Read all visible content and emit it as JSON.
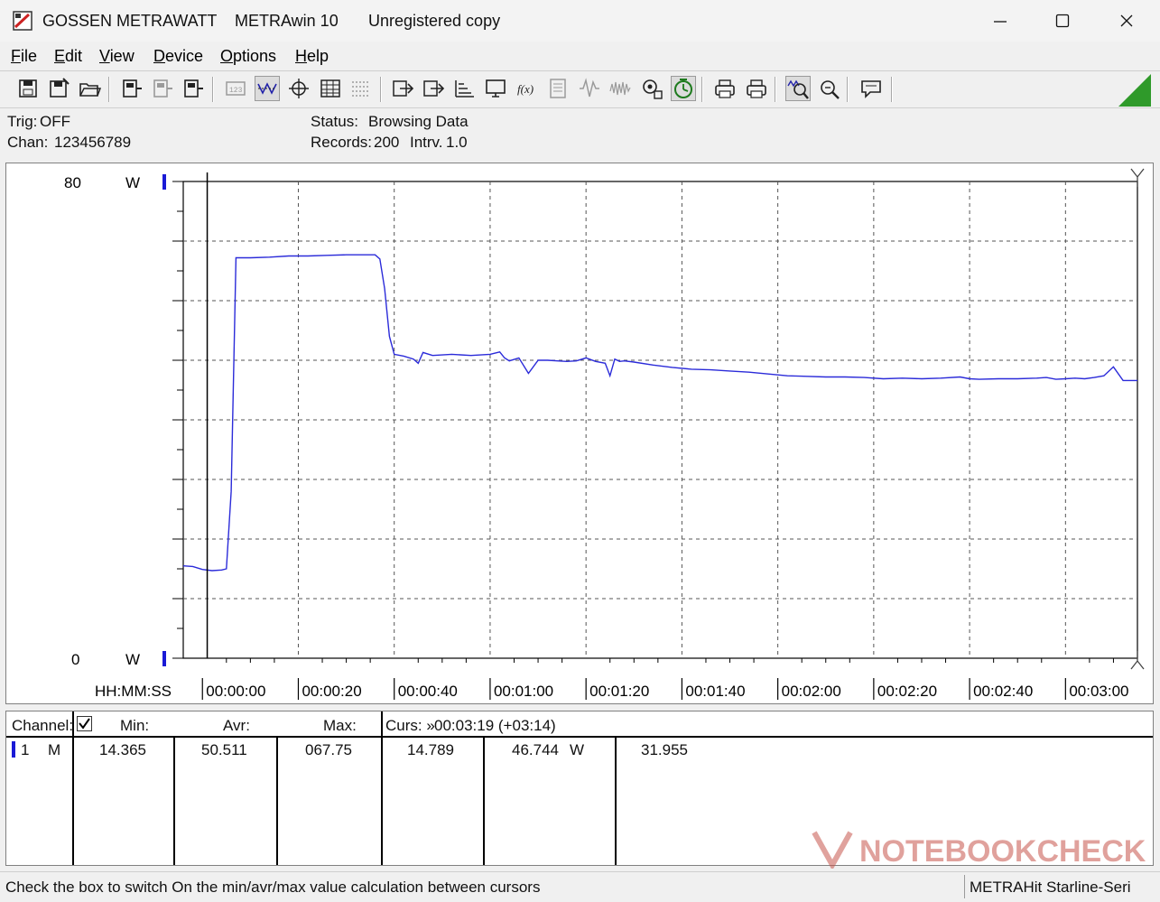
{
  "window": {
    "brand": "GOSSEN METRAWATT",
    "app": "METRAwin 10",
    "registration": "Unregistered copy"
  },
  "menu": [
    {
      "label": "File",
      "key": "F",
      "rest": "ile"
    },
    {
      "label": "Edit",
      "key": "E",
      "rest": "dit"
    },
    {
      "label": "View",
      "key": "V",
      "rest": "iew"
    },
    {
      "label": "Device",
      "key": "D",
      "rest": "evice"
    },
    {
      "label": "Options",
      "key": "O",
      "rest": "ptions"
    },
    {
      "label": "Help",
      "key": "H",
      "rest": "elp"
    }
  ],
  "toolbar_icons": [
    "save-icon",
    "save-as-icon",
    "open-folder-icon",
    "device-read-icon",
    "device-config-icon",
    "device-send-icon",
    "digital-display-icon",
    "waveform-icon",
    "crosshair-icon",
    "table-icon",
    "list-icon",
    "export-icon",
    "import-icon",
    "scale-icon",
    "monitor-icon",
    "formula-icon",
    "memory-icon",
    "signal-icon",
    "noise-icon",
    "settings-icon",
    "timer-icon",
    "print-preview-icon",
    "print-icon",
    "zoom-wave-icon",
    "zoom-icon",
    "message-icon"
  ],
  "info": {
    "trig_label": "Trig:",
    "trig_value": "OFF",
    "chan_label": "Chan:",
    "chan_value": "123456789",
    "status_label": "Status:",
    "status_value": "Browsing Data",
    "records_label": "Records:",
    "records_value": "200",
    "interval_label": "Intrv.",
    "interval_value": "1.0"
  },
  "chart_data": {
    "type": "line",
    "xlabel": "HH:MM:SS",
    "y_top_label": "80",
    "y_bottom_label": "0",
    "y_unit": "W",
    "ylim": [
      0,
      80
    ],
    "xlim": [
      -4,
      195
    ],
    "x_tick_labels": [
      "00:00:00",
      "00:00:20",
      "00:00:40",
      "00:01:00",
      "00:01:20",
      "00:01:40",
      "00:02:00",
      "00:02:20",
      "00:02:40",
      "00:03:00"
    ],
    "x_tick_values": [
      0,
      20,
      40,
      60,
      80,
      100,
      120,
      140,
      160,
      180
    ],
    "grid": true,
    "line_color": "#2b2bd9",
    "cursor_x": 1,
    "series": [
      {
        "x": [
          -4,
          -2,
          0,
          2,
          4,
          5,
          6,
          7,
          8,
          10,
          14,
          18,
          22,
          26,
          30,
          34,
          36,
          37,
          38,
          39,
          40,
          42,
          44,
          45,
          46,
          48,
          52,
          56,
          60,
          62,
          63,
          64,
          66,
          68,
          70,
          72,
          74,
          76,
          78,
          80,
          82,
          84,
          85,
          86,
          87,
          88,
          90,
          94,
          98,
          102,
          106,
          110,
          114,
          118,
          122,
          126,
          130,
          134,
          138,
          142,
          146,
          150,
          154,
          158,
          160,
          162,
          166,
          170,
          174,
          176,
          178,
          180,
          182,
          184,
          186,
          188,
          190,
          192,
          195
        ],
        "y": [
          15.5,
          15.4,
          14.9,
          14.7,
          14.8,
          15.0,
          28.0,
          67.2,
          67.2,
          67.2,
          67.3,
          67.5,
          67.5,
          67.6,
          67.7,
          67.7,
          67.7,
          67.0,
          62.0,
          54.0,
          51.0,
          50.7,
          50.2,
          49.5,
          51.3,
          50.8,
          51.0,
          50.8,
          51.0,
          51.4,
          50.4,
          49.9,
          50.4,
          47.8,
          50.0,
          50.0,
          49.9,
          49.8,
          49.9,
          50.4,
          49.8,
          49.5,
          47.4,
          50.2,
          49.8,
          49.9,
          49.7,
          49.2,
          48.8,
          48.5,
          48.4,
          48.2,
          48.0,
          47.7,
          47.4,
          47.3,
          47.2,
          47.2,
          47.1,
          46.9,
          47.0,
          46.9,
          47.0,
          47.2,
          46.9,
          46.8,
          46.9,
          46.9,
          47.0,
          47.1,
          46.8,
          46.9,
          47.0,
          46.9,
          47.1,
          47.4,
          48.9,
          46.6,
          46.6
        ]
      }
    ]
  },
  "table": {
    "channel_header": "Channel:",
    "min_header": "Min:",
    "avr_header": "Avr:",
    "max_header": "Max:",
    "curs_label": "Curs: »",
    "curs_value": "00:03:19 (+03:14)",
    "row": {
      "channel": "1",
      "mode": "M",
      "min": "14.365",
      "avr": "50.511",
      "max": "067.75",
      "cursor1": "14.789",
      "cursor2": "46.744",
      "unit": "W",
      "delta": "31.955"
    }
  },
  "status": {
    "hint": "Check the box to switch On the min/avr/max value calculation between cursors",
    "device": "METRAHit Starline-Seri"
  },
  "watermark": "NOTEBOOKCHECK",
  "colors": {
    "accent": "#2f9a2a",
    "channel_marker": "#1a1ad6",
    "watermark": "#c7564c"
  }
}
